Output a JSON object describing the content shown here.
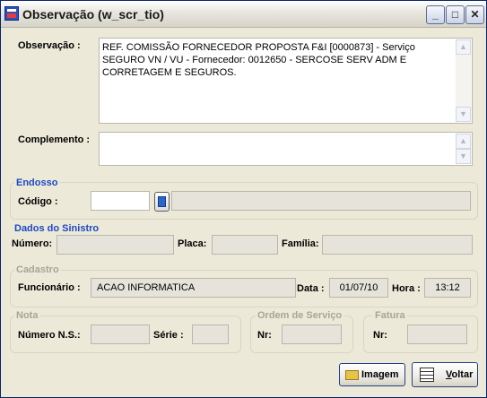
{
  "window": {
    "title": "Observação (w_scr_tio)",
    "minimize": "_",
    "maximize": "□",
    "close": "✕"
  },
  "observacao": {
    "label": "Observação :",
    "text": "REF. COMISSÃO FORNECEDOR PROPOSTA F&I [0000873] - Serviço SEGURO VN / VU - Fornecedor: 0012650 - SERCOSE SERV ADM E CORRETAGEM E SEGUROS."
  },
  "complemento": {
    "label": "Complemento :",
    "text": ""
  },
  "endosso": {
    "title": "Endosso",
    "codigo_label": "Código :",
    "codigo_value": "",
    "descricao_value": ""
  },
  "sinistro": {
    "title": "Dados do Sinistro",
    "numero_label": "Número:",
    "numero_value": "",
    "placa_label": "Placa:",
    "placa_value": "",
    "familia_label": "Família:",
    "familia_value": ""
  },
  "cadastro": {
    "title": "Cadastro",
    "funcionario_label": "Funcionário :",
    "funcionario_value": "ACAO INFORMATICA",
    "data_label": "Data :",
    "data_value": "01/07/10",
    "hora_label": "Hora :",
    "hora_value": "13:12"
  },
  "nota": {
    "title": "Nota",
    "numero_ns_label": "Número N.S.:",
    "numero_ns_value": "",
    "serie_label": "Série :",
    "serie_value": ""
  },
  "ordem_servico": {
    "title": "Ordem de Serviço",
    "nr_label": "Nr:",
    "nr_value": ""
  },
  "fatura": {
    "title": "Fatura",
    "nr_label": "Nr:",
    "nr_value": ""
  },
  "buttons": {
    "imagem": "Imagem",
    "voltar_first": "V",
    "voltar_rest": "oltar"
  },
  "scroll": {
    "up": "▲",
    "down": "▼"
  }
}
